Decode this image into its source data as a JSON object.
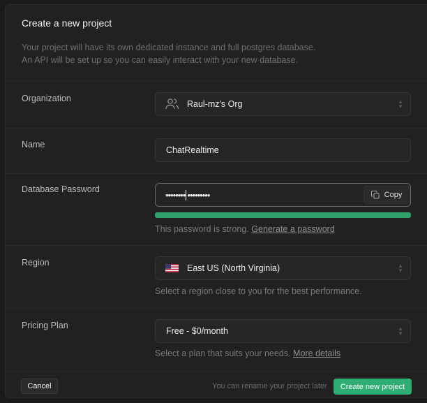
{
  "header": {
    "title": "Create a new project",
    "description_line1": "Your project will have its own dedicated instance and full postgres database.",
    "description_line2": "An API will be set up so you can easily interact with your new database."
  },
  "organization": {
    "label": "Organization",
    "value": "Raul-mz's Org",
    "icon": "users-icon"
  },
  "name": {
    "label": "Name",
    "value": "ChatRealtime"
  },
  "password": {
    "label": "Database Password",
    "value_masked": "••••••••",
    "value_masked_after": "•••••••••",
    "copy_label": "Copy",
    "strength_percent": 100,
    "strength_color": "#2fa26b",
    "hint": "This password is strong.",
    "generate_link": "Generate a password"
  },
  "region": {
    "label": "Region",
    "value": "East US (North Virginia)",
    "flag": "us-flag-icon",
    "hint": "Select a region close to you for the best performance."
  },
  "pricing": {
    "label": "Pricing Plan",
    "value": "Free - $0/month",
    "hint": "Select a plan that suits your needs.",
    "more_link": "More details"
  },
  "footer": {
    "cancel_label": "Cancel",
    "note": "You can rename your project later",
    "create_label": "Create new project",
    "accent": "#2fae74"
  }
}
